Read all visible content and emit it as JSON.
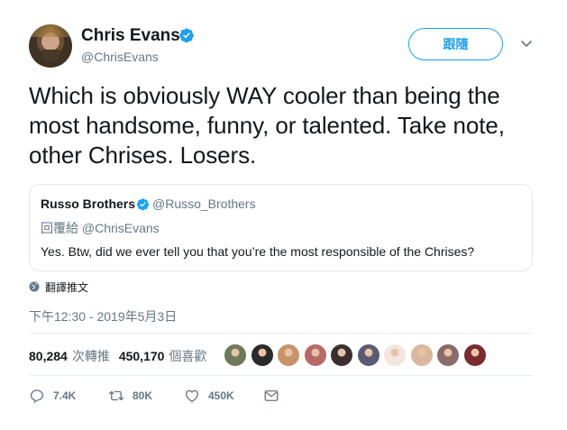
{
  "header": {
    "display_name": "Chris Evans",
    "handle": "@ChrisEvans",
    "follow_label": "跟隨"
  },
  "tweet": {
    "text": "Which is obviously WAY cooler than being the most handsome, funny, or talented. Take note, other Chrises. Losers."
  },
  "quote": {
    "name": "Russo Brothers",
    "handle": "@Russo_Brothers",
    "reply_to": "回覆給 @ChrisEvans",
    "text": "Yes. Btw, did we ever tell you that you’re the most responsible of the Chrises?"
  },
  "translate_label": "翻譯推文",
  "timestamp": "下午12:30 - 2019年5月3日",
  "stats": {
    "retweets_count": "80,284",
    "retweets_label": "次轉推",
    "likes_count": "450,170",
    "likes_label": "個喜歡"
  },
  "likers": [
    {
      "color": "#6f7a5a"
    },
    {
      "color": "#2a2a2a"
    },
    {
      "color": "#c8926a"
    },
    {
      "color": "#b86a6a"
    },
    {
      "color": "#3a2f2f"
    },
    {
      "color": "#5a5a72"
    },
    {
      "color": "#f2e6de"
    },
    {
      "color": "#d9b7a0"
    },
    {
      "color": "#8a6a6a"
    },
    {
      "color": "#7a2a30"
    }
  ],
  "actions": {
    "reply_count": "7.4K",
    "retweet_count": "80K",
    "like_count": "450K"
  },
  "colors": {
    "accent": "#1da1f2",
    "secondary_text": "#657786",
    "divider": "#e6ecf0"
  },
  "icons": [
    "verified-badge-icon",
    "chevron-down-icon",
    "globe-icon",
    "reply-icon",
    "retweet-icon",
    "heart-icon",
    "dm-icon"
  ]
}
